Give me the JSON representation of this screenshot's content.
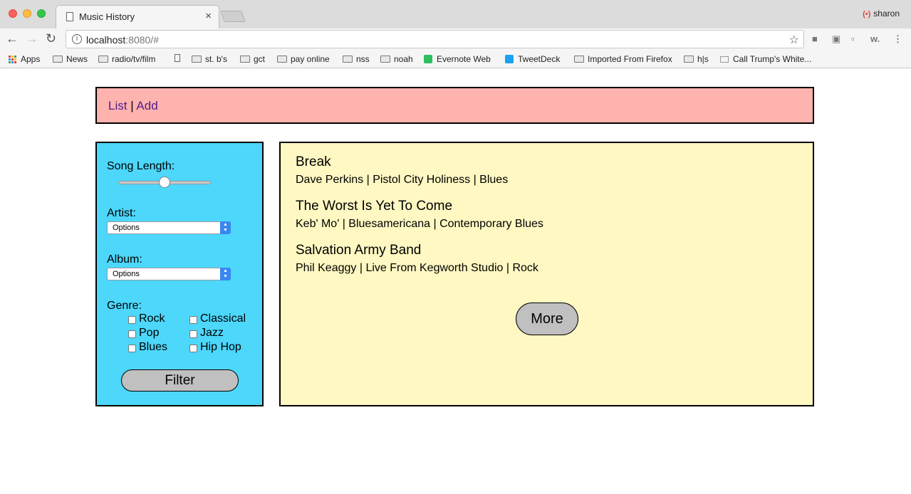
{
  "browser": {
    "tab_title": "Music History",
    "tab_close": "×",
    "profile_name": "sharon",
    "url_host": "localhost",
    "url_rest": ":8080/#",
    "bookmarks": {
      "apps": "Apps",
      "news": "News",
      "radio": "radio/tv/film",
      "stbs": "st. b's",
      "gct": "gct",
      "payonline": "pay online",
      "nss": "nss",
      "noah": "noah",
      "evernote": "Evernote Web",
      "tweetdeck": "TweetDeck",
      "imported": "Imported From Firefox",
      "hs": "h|s",
      "calltrump": "Call Trump's White..."
    }
  },
  "nav": {
    "list_label": "List",
    "separator": "|",
    "add_label": "Add"
  },
  "filters": {
    "song_length_label": "Song Length:",
    "song_length_value": 0.5,
    "artist_label": "Artist:",
    "artist_selected": "Options",
    "album_label": "Album:",
    "album_selected": "Options",
    "genre_label": "Genre:",
    "genres": [
      "Rock",
      "Classical",
      "Pop",
      "Jazz",
      "Blues",
      "Hip Hop"
    ],
    "filter_button": "Filter"
  },
  "songs": [
    {
      "title": "Break",
      "meta": "Dave Perkins | Pistol City Holiness | Blues"
    },
    {
      "title": "The Worst Is Yet To Come",
      "meta": "Keb' Mo' | Bluesamericana | Contemporary Blues"
    },
    {
      "title": "Salvation Army Band",
      "meta": "Phil Keaggy | Live From Kegworth Studio | Rock"
    }
  ],
  "more_button": "More",
  "colors": {
    "navbar_bg": "#ffb3ae",
    "sidebar_bg": "#4cd7fb",
    "content_bg": "#fff8c2",
    "button_bg": "#c0c0c0"
  }
}
